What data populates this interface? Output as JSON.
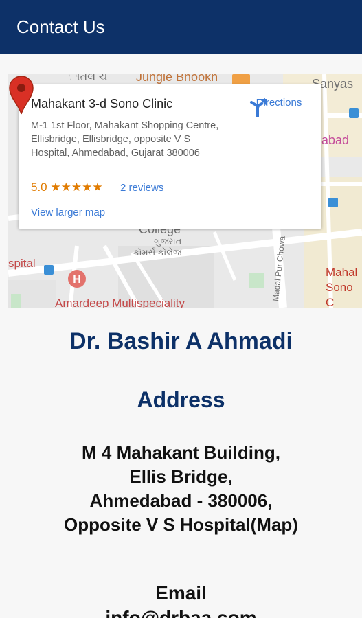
{
  "app_bar": {
    "title": "Contact Us",
    "color": "#0d3168"
  },
  "map": {
    "labels": {
      "top_left": "ાતલ ચે",
      "jungle": "Jungle Bhookh",
      "sanyas": "Sanyas",
      "bad": "abad",
      "college": "College",
      "gujarat_gu": "ગુજરાત",
      "commerce_gu": "કૉમર્સ કોલેજ",
      "hospital": "spital",
      "amardeep": "Amardeep Multispeciality",
      "road": "Madal Pur Chowa",
      "pin_label_line1": "Mahal",
      "pin_label_line2": "Sono C"
    },
    "card": {
      "name": "Mahakant 3-d Sono Clinic",
      "address": "M-1 1st Floor, Mahakant Shopping Centre, Ellisbridge, Ellisbridge, opposite V S Hospital, Ahmedabad, Gujarat 380006",
      "rating": "5.0",
      "stars": "★★★★★",
      "reviews": "2 reviews",
      "larger_map": "View larger map",
      "directions": "Directions"
    }
  },
  "doctor": {
    "name": "Dr. Bashir A Ahmadi"
  },
  "address": {
    "heading": "Address",
    "lines": [
      "M 4 Mahakant Building,",
      "Ellis Bridge,",
      "Ahmedabad - 380006,",
      "Opposite V S Hospital(Map)"
    ]
  },
  "email": {
    "heading": "Email",
    "value": "info@drbaa.com"
  },
  "colors": {
    "accent": "#0d3168",
    "link": "#3a7ad6",
    "star": "#e07b00",
    "pin": "#d93025"
  }
}
